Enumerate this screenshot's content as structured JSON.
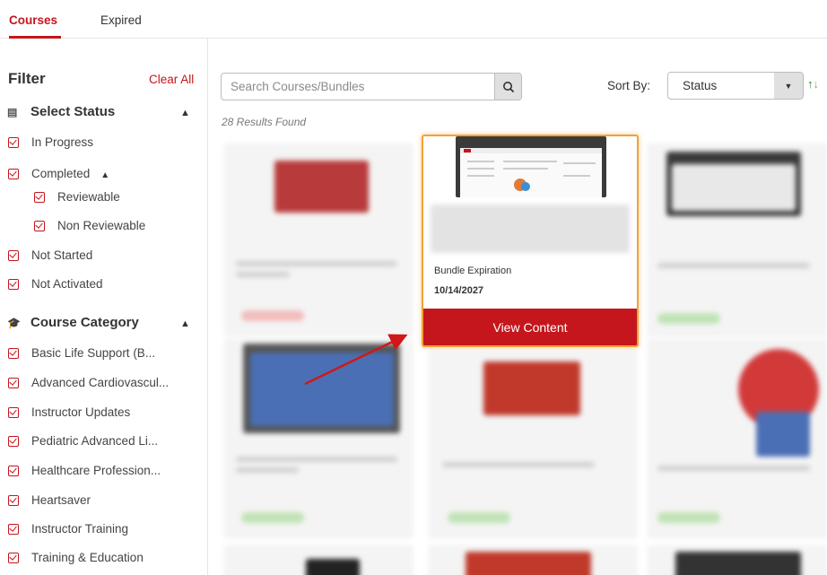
{
  "tabs": {
    "courses": "Courses",
    "expired": "Expired"
  },
  "filter": {
    "title": "Filter",
    "clear_all": "Clear All",
    "status_section": {
      "label": "Select Status",
      "icon": "clipboard-icon",
      "items": [
        "In Progress",
        "Completed",
        "Not Started",
        "Not Activated"
      ],
      "completed_sub": [
        "Reviewable",
        "Non Reviewable"
      ]
    },
    "category_section": {
      "label": "Course Category",
      "icon": "graduation-cap-icon",
      "items": [
        "Basic Life Support (B...",
        "Advanced Cardiovascul...",
        "Instructor Updates",
        "Pediatric Advanced Li...",
        "Healthcare Profession...",
        "Heartsaver",
        "Instructor Training",
        "Training & Education"
      ]
    }
  },
  "search": {
    "placeholder": "Search Courses/Bundles",
    "icon": "search-icon"
  },
  "results_text": "28 Results Found",
  "sort": {
    "label": "Sort By:",
    "value": "Status",
    "icons": [
      "arrow-up-icon",
      "arrow-down-icon"
    ]
  },
  "featured_card": {
    "expiration_label": "Bundle Expiration",
    "expiration_date": "10/14/2027",
    "button_label": "View Content"
  },
  "colors": {
    "accent": "#c4161c",
    "highlight": "#f0a23a",
    "sort_up": "#2e8b2e"
  }
}
